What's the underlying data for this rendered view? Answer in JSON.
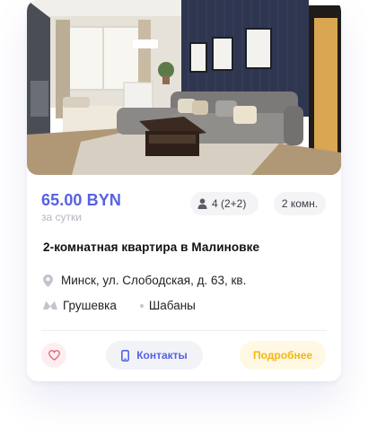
{
  "listing": {
    "price": "65.00 BYN",
    "price_period": "за сутки",
    "guests": "4 (2+2)",
    "rooms": "2 комн.",
    "title": "2-комнатная квартира в Малиновке",
    "address": "Минск, ул. Слободская, д. 63, кв.",
    "metro_station": "Грушевка",
    "district": "Шабаны"
  },
  "actions": {
    "contacts_label": "Контакты",
    "details_label": "Подробнее"
  },
  "icons": {
    "guests": "person-icon",
    "address": "location-pin-icon",
    "metro": "metro-icon",
    "favorite": "heart-icon",
    "contacts": "phone-icon"
  },
  "colors": {
    "accent": "#5561e4",
    "secondary_text": "#b4b7c4",
    "favorite": "#e4667b",
    "details": "#f3b713"
  }
}
